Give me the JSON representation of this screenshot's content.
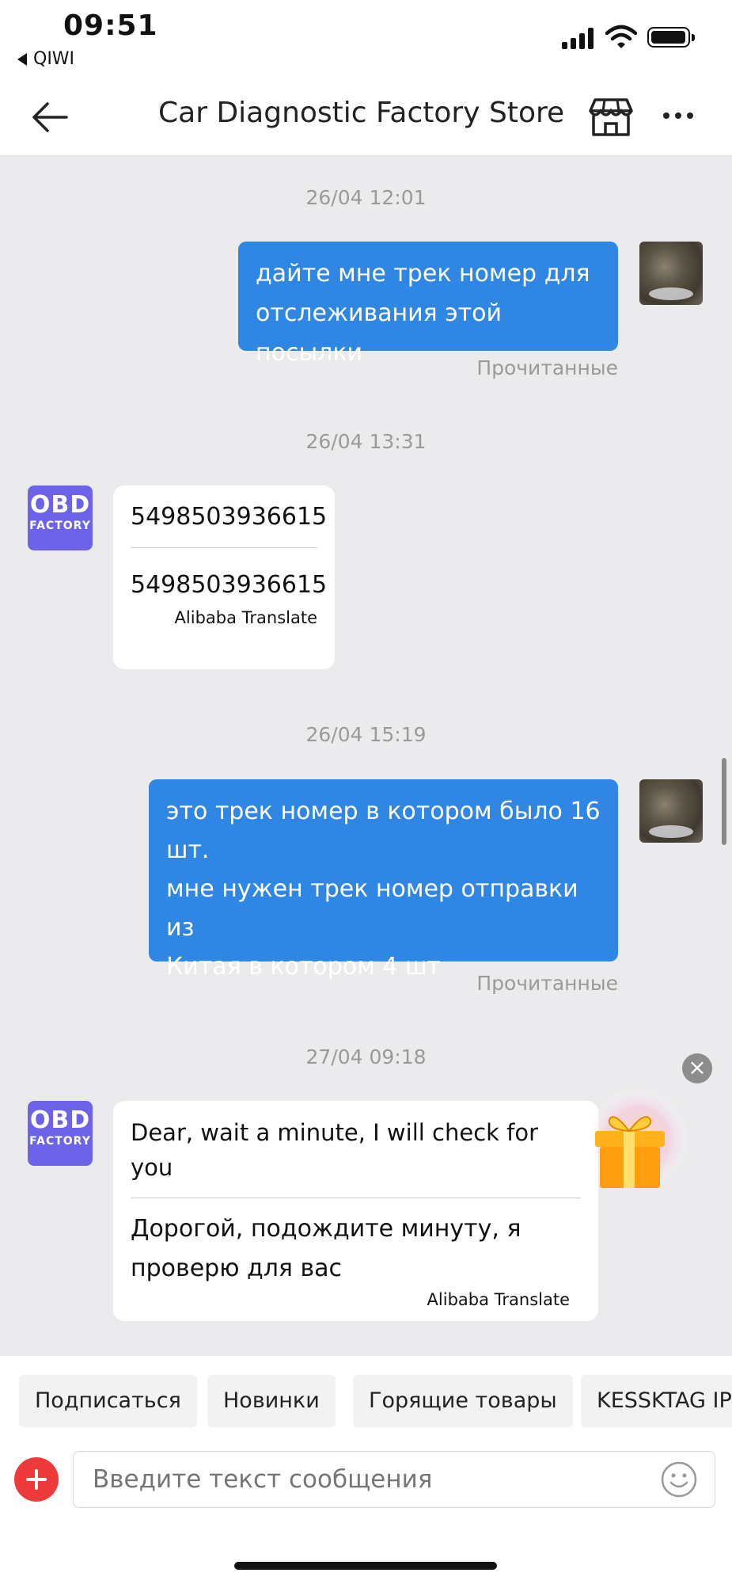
{
  "status_bar": {
    "time": "09:51",
    "back_app": "QIWI"
  },
  "header": {
    "title": "Car Diagnostic Factory Store"
  },
  "shop_avatar": {
    "line1": "OBD",
    "line2": "FACTORY"
  },
  "messages": [
    {
      "timestamp": "26/04 12:01",
      "text": "дайте мне трек номер для\nотслеживания этой посылки",
      "status": "Прочитанные"
    },
    {
      "timestamp": "26/04 13:31",
      "original": "5498503936615",
      "translation": "5498503936615",
      "translator": "Alibaba Translate"
    },
    {
      "timestamp": "26/04 15:19",
      "text": "это трек номер в котором было 16\nшт.\nмне нужен трек номер отправки из\nКитая в котором 4 шт",
      "status": "Прочитанные"
    },
    {
      "timestamp": "27/04 09:18",
      "original": "Dear, wait a minute, I will check for you",
      "translation": "Дорогой, подождите минуту, я проверю для вас",
      "translator": "Alibaba Translate"
    }
  ],
  "quick_replies": [
    "Подписаться",
    "Новинки",
    "Горящие товары",
    "KESSKTAG IPR"
  ],
  "input": {
    "placeholder": "Введите текст сообщения"
  },
  "colors": {
    "outgoing_bubble": "#2f87e3",
    "chat_background": "#ebebed",
    "shop_avatar": "#6c63e9",
    "add_button": "#ee3a3a"
  }
}
